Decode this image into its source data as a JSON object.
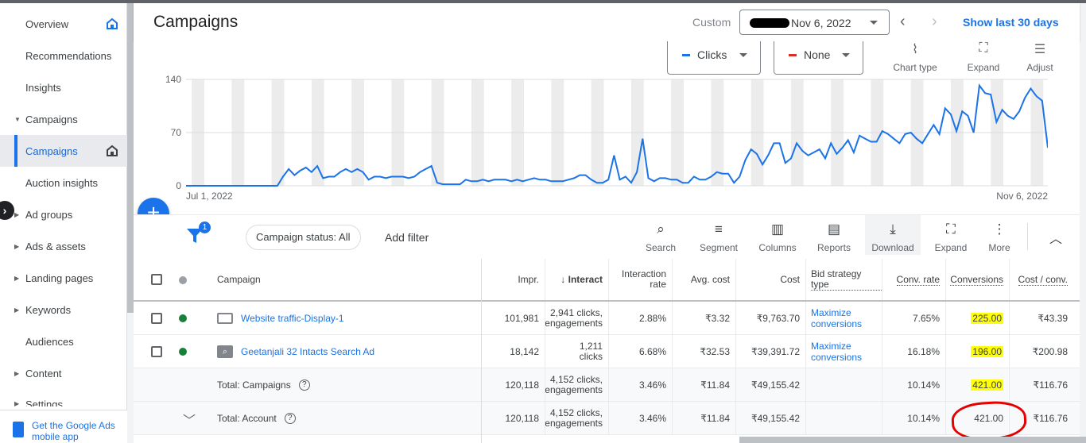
{
  "sidebar": {
    "items": [
      {
        "label": "Overview",
        "arrow": ""
      },
      {
        "label": "Recommendations",
        "arrow": ""
      },
      {
        "label": "Insights",
        "arrow": ""
      },
      {
        "label": "Campaigns",
        "arrow": "▼"
      },
      {
        "label": "Campaigns",
        "arrow": ""
      },
      {
        "label": "Auction insights",
        "arrow": ""
      },
      {
        "label": "Ad groups",
        "arrow": "▶"
      },
      {
        "label": "Ads & assets",
        "arrow": "▶"
      },
      {
        "label": "Landing pages",
        "arrow": "▶"
      },
      {
        "label": "Keywords",
        "arrow": "▶"
      },
      {
        "label": "Audiences",
        "arrow": ""
      },
      {
        "label": "Content",
        "arrow": "▶"
      },
      {
        "label": "Settings",
        "arrow": "▶"
      }
    ],
    "app_link": "Get the Google Ads mobile app"
  },
  "header": {
    "title": "Campaigns",
    "custom_label": "Custom",
    "date_range": "Nov 6, 2022",
    "show_last": "Show last 30 days"
  },
  "chart_controls": {
    "metric1": "Clicks",
    "metric1_color": "#1a73e8",
    "metric2": "None",
    "metric2_color": "#d93025",
    "chart_type": "Chart type",
    "expand": "Expand",
    "adjust": "Adjust"
  },
  "chart_data": {
    "type": "line",
    "x_start_label": "Jul 1, 2022",
    "x_end_label": "Nov 6, 2022",
    "yticks": [
      "0",
      "70",
      "140"
    ],
    "ylim": [
      0,
      140
    ],
    "series": [
      {
        "name": "Clicks",
        "color": "#1a73e8",
        "values": [
          0,
          0,
          0,
          0,
          0,
          0,
          0,
          0,
          0,
          0,
          0,
          0,
          0,
          0,
          0,
          0,
          0,
          12,
          22,
          14,
          20,
          24,
          18,
          26,
          10,
          12,
          12,
          18,
          22,
          18,
          22,
          18,
          8,
          12,
          12,
          10,
          12,
          12,
          12,
          10,
          12,
          18,
          22,
          26,
          4,
          2,
          2,
          2,
          2,
          8,
          6,
          6,
          8,
          6,
          8,
          8,
          8,
          6,
          8,
          6,
          8,
          10,
          8,
          8,
          6,
          6,
          6,
          8,
          10,
          14,
          14,
          8,
          4,
          4,
          8,
          40,
          8,
          12,
          4,
          18,
          62,
          10,
          6,
          10,
          10,
          8,
          8,
          4,
          4,
          12,
          8,
          8,
          12,
          18,
          16,
          16,
          4,
          12,
          34,
          48,
          42,
          28,
          40,
          56,
          56,
          30,
          36,
          56,
          46,
          40,
          44,
          48,
          36,
          56,
          42,
          50,
          60,
          44,
          66,
          62,
          58,
          58,
          72,
          68,
          62,
          56,
          68,
          70,
          62,
          56,
          68,
          80,
          68,
          102,
          94,
          72,
          98,
          92,
          70,
          132,
          122,
          120,
          84,
          100,
          92,
          88,
          98,
          116,
          128,
          118,
          112,
          50
        ]
      }
    ],
    "xlabel": "",
    "ylabel": ""
  },
  "toolbar": {
    "filter_badge": "1",
    "chip": "Campaign status: All",
    "add_filter": "Add filter",
    "tools": [
      "Search",
      "Segment",
      "Columns",
      "Reports",
      "Download",
      "Expand",
      "More"
    ],
    "fab": "+"
  },
  "table": {
    "headers": {
      "campaign": "Campaign",
      "impr": "Impr.",
      "interactions": "Interact",
      "interaction_rate": "Interaction rate",
      "avg_cost": "Avg. cost",
      "cost": "Cost",
      "bid_strategy": "Bid strategy type",
      "conv_rate": "Conv. rate",
      "conversions": "Conversions",
      "cost_conv": "Cost / conv."
    },
    "rows": [
      {
        "campaign": "Website traffic-Display-1",
        "impr": "101,981",
        "interactions": "2,941 clicks, engagements",
        "interaction_rate": "2.88%",
        "avg_cost": "₹3.32",
        "cost": "₹9,763.70",
        "bid_strategy": "Maximize conversions",
        "conv_rate": "7.65%",
        "conversions": "225.00",
        "cost_conv": "₹43.39"
      },
      {
        "campaign": "Geetanjali 32 Intacts Search Ad",
        "impr": "18,142",
        "interactions": "1,211 clicks",
        "interaction_rate": "6.68%",
        "avg_cost": "₹32.53",
        "cost": "₹39,391.72",
        "bid_strategy": "Maximize conversions",
        "conv_rate": "16.18%",
        "conversions": "196.00",
        "cost_conv": "₹200.98"
      }
    ],
    "total_campaigns": {
      "label": "Total: Campaigns",
      "impr": "120,118",
      "interactions": "4,152 clicks, engagements",
      "interaction_rate": "3.46%",
      "avg_cost": "₹11.84",
      "cost": "₹49,155.42",
      "conv_rate": "10.14%",
      "conversions": "421.00",
      "cost_conv": "₹116.76"
    },
    "total_account": {
      "label": "Total: Account",
      "impr": "120,118",
      "interactions": "4,152 clicks, engagements",
      "interaction_rate": "3.46%",
      "avg_cost": "₹11.84",
      "cost": "₹49,155.42",
      "conv_rate": "10.14%",
      "conversions": "421.00",
      "cost_conv": "₹116.76"
    }
  }
}
